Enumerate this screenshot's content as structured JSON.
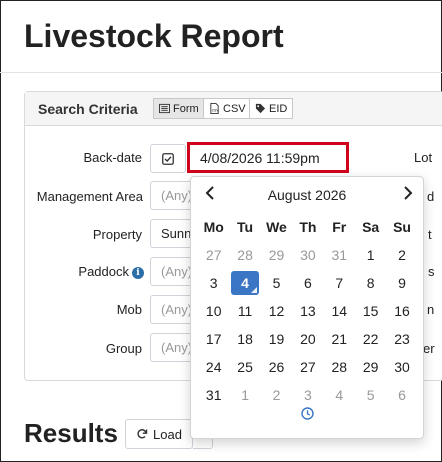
{
  "page": {
    "title": "Livestock Report"
  },
  "search": {
    "title": "Search Criteria",
    "tabs": [
      {
        "label": "Form",
        "icon": "form-icon"
      },
      {
        "label": "CSV",
        "icon": "csv-file-icon"
      },
      {
        "label": "EID",
        "icon": "tag-icon"
      }
    ],
    "fields": {
      "backdate_label": "Back-date",
      "backdate_value": "4/08/2026 11:59pm",
      "management_area_label": "Management Area",
      "management_area_value": "(Any)",
      "property_label": "Property",
      "property_value": "Sunn",
      "paddock_label": "Paddock",
      "paddock_value": "(Any)",
      "mob_label": "Mob",
      "mob_value": "(Any)",
      "group_label": "Group",
      "group_value": "(Any)"
    },
    "right_fragments": {
      "lot": "Lot",
      "r2": "d",
      "r3": "t",
      "r4": "s",
      "r5": "n",
      "r6": "er"
    }
  },
  "datepicker": {
    "month_label": "August 2026",
    "prev_icon": "chevron-left-icon",
    "next_icon": "chevron-right-icon",
    "weekdays": [
      "Mo",
      "Tu",
      "We",
      "Th",
      "Fr",
      "Sa",
      "Su"
    ],
    "weeks": [
      [
        "27",
        "28",
        "29",
        "30",
        "31",
        "1",
        "2"
      ],
      [
        "3",
        "4",
        "5",
        "6",
        "7",
        "8",
        "9"
      ],
      [
        "10",
        "11",
        "12",
        "13",
        "14",
        "15",
        "16"
      ],
      [
        "17",
        "18",
        "19",
        "20",
        "21",
        "22",
        "23"
      ],
      [
        "24",
        "25",
        "26",
        "27",
        "28",
        "29",
        "30"
      ],
      [
        "31",
        "1",
        "2",
        "3",
        "4",
        "5",
        "6"
      ]
    ],
    "selected_day": "4",
    "clock_icon": "clock-icon"
  },
  "results": {
    "title": "Results",
    "load_label": "Load",
    "load_icon": "refresh-icon"
  },
  "colors": {
    "accent": "#3a76c4",
    "highlight": "#d0021b",
    "info": "#2c6fa8"
  }
}
